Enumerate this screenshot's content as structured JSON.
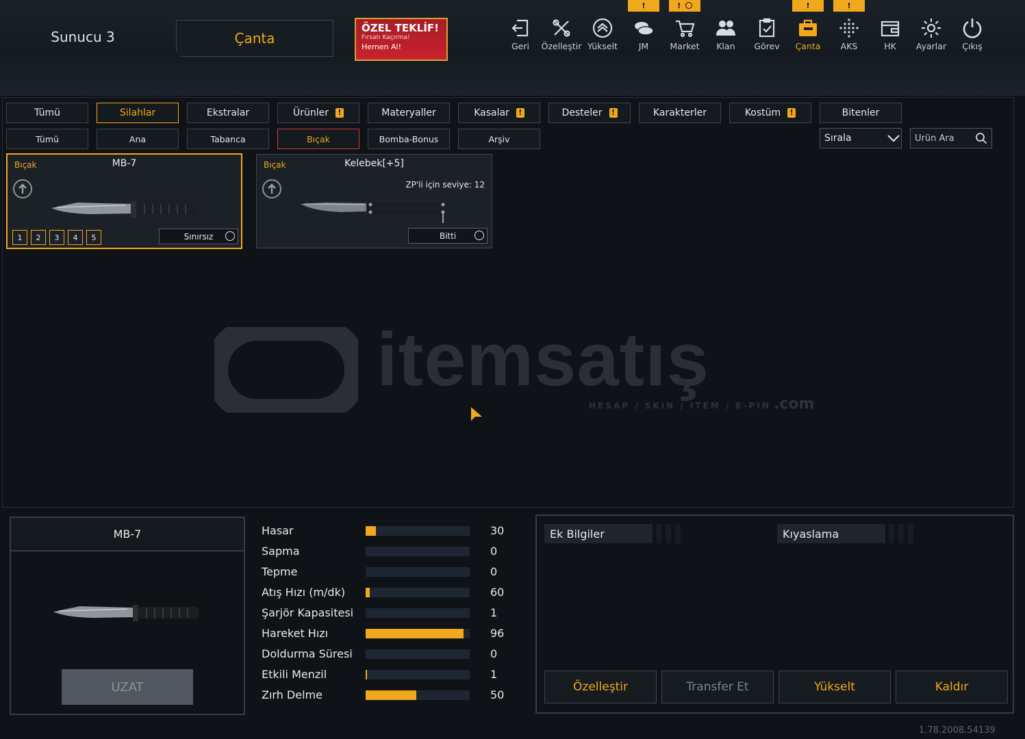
{
  "header": {
    "server": "Sunucu 3",
    "title": "Çanta",
    "offer": {
      "line1": "ÖZEL TEKLİF!",
      "line2": "Fırsatı Kaçırma!",
      "line3": "Hemen Al!"
    }
  },
  "nav": [
    {
      "label": "Geri",
      "icon": "back-icon"
    },
    {
      "label": "Özelleştir",
      "icon": "tools-icon"
    },
    {
      "label": "Yükselt",
      "icon": "rank-up-icon"
    },
    {
      "label": "JM",
      "icon": "coins-icon",
      "badge": "!"
    },
    {
      "label": "Market",
      "icon": "cart-icon",
      "badge": "!"
    },
    {
      "label": "Klan",
      "icon": "clan-icon"
    },
    {
      "label": "Görev",
      "icon": "clipboard-icon"
    },
    {
      "label": "Çanta",
      "icon": "bag-icon",
      "badge": "!"
    },
    {
      "label": "AKS",
      "icon": "dots-grid-icon",
      "badge": "!"
    },
    {
      "label": "HK",
      "icon": "wallet-icon"
    },
    {
      "label": "Ayarlar",
      "icon": "gear-icon"
    },
    {
      "label": "Çıkış",
      "icon": "power-icon"
    }
  ],
  "tabs": [
    {
      "label": "Tümü",
      "active": false,
      "warn": false
    },
    {
      "label": "Silahlar",
      "active": true,
      "warn": false
    },
    {
      "label": "Ekstralar",
      "active": false,
      "warn": false
    },
    {
      "label": "Ürünler",
      "active": false,
      "warn": true
    },
    {
      "label": "Materyaller",
      "active": false,
      "warn": false
    },
    {
      "label": "Kasalar",
      "active": false,
      "warn": true
    },
    {
      "label": "Desteler",
      "active": false,
      "warn": true
    },
    {
      "label": "Karakterler",
      "active": false,
      "warn": false
    },
    {
      "label": "Kostüm",
      "active": false,
      "warn": true
    },
    {
      "label": "Bitenler",
      "active": false,
      "warn": false
    }
  ],
  "subtabs": [
    {
      "label": "Tümü",
      "active": false
    },
    {
      "label": "Ana",
      "active": false
    },
    {
      "label": "Tabanca",
      "active": false
    },
    {
      "label": "Bıçak",
      "active": true
    },
    {
      "label": "Bomba-Bonus",
      "active": false
    },
    {
      "label": "Arşiv",
      "active": false
    }
  ],
  "controls": {
    "sort_label": "Sırala",
    "search_placeholder": "Ürün Ara"
  },
  "items": [
    {
      "category": "Bıçak",
      "name": "MB-7",
      "duration": "Sınırsız",
      "levels": [
        "1",
        "2",
        "3",
        "4",
        "5"
      ],
      "selected": true
    },
    {
      "category": "Bıçak",
      "name": "Kelebek[+5]",
      "level_req": "ZP'li için seviye: 12",
      "duration": "Bitti",
      "selected": false
    }
  ],
  "watermark": {
    "text": "itemsatış",
    "sub": "HESAP / SKIN / ITEM / E-PIN",
    "com": ".com"
  },
  "detail": {
    "name": "MB-7",
    "extend_label": "UZAT",
    "stats": [
      {
        "label": "Hasar",
        "value": "30",
        "fill": 0.1
      },
      {
        "label": "Sapma",
        "value": "0",
        "fill": 0
      },
      {
        "label": "Tepme",
        "value": "0",
        "fill": 0
      },
      {
        "label": "Atış Hızı (m/dk)",
        "value": "60",
        "fill": 0.04
      },
      {
        "label": "Şarjör Kapasitesi",
        "value": "1",
        "fill": 0
      },
      {
        "label": "Hareket Hızı",
        "value": "96",
        "fill": 0.94
      },
      {
        "label": "Doldurma Süresi",
        "value": "0",
        "fill": 0
      },
      {
        "label": "Etkili Menzil",
        "value": "1",
        "fill": 0.01
      },
      {
        "label": "Zırh Delme",
        "value": "50",
        "fill": 0.49
      }
    ],
    "info_title": "Ek Bilgiler",
    "compare_title": "Kıyaslama",
    "actions": [
      {
        "label": "Özelleştir",
        "color": "#f2a81d"
      },
      {
        "label": "Transfer Et",
        "color": "#7d848b"
      },
      {
        "label": "Yükselt",
        "color": "#f2a81d"
      },
      {
        "label": "Kaldır",
        "color": "#f2a81d"
      }
    ]
  },
  "version": "1.78.2008.54139",
  "colors": {
    "accent": "#f2a81d",
    "bg": "#0f1317",
    "red": "#c8222d"
  }
}
